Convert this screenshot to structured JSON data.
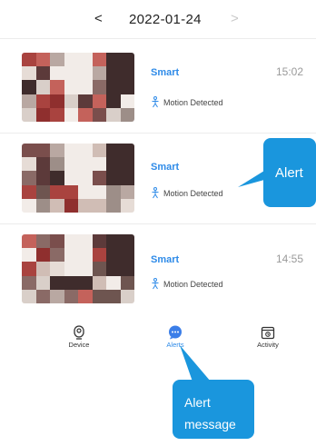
{
  "date_nav": {
    "prev_icon": "chevron-left-icon",
    "prev_glyph": "<",
    "date": "2022-01-24",
    "next_icon": "chevron-right-icon",
    "next_glyph": ">"
  },
  "events": [
    {
      "title": "Smart",
      "time": "15:02",
      "type": "Motion Detected",
      "icon": "motion-person-icon"
    },
    {
      "title": "Smart",
      "time": "",
      "type": "Motion Detected",
      "icon": "motion-person-icon"
    },
    {
      "title": "Smart",
      "time": "14:55",
      "type": "Motion Detected",
      "icon": "motion-person-icon"
    }
  ],
  "tabs": [
    {
      "label": "Device",
      "icon": "camera-icon",
      "active": false
    },
    {
      "label": "Alerts",
      "icon": "chat-bubble-icon",
      "active": true
    },
    {
      "label": "Activity",
      "icon": "activity-icon",
      "active": false
    }
  ],
  "callouts": [
    {
      "text": "Alert"
    },
    {
      "line1": "Alert",
      "line2": "message"
    }
  ],
  "colors": {
    "accent": "#2f8be8",
    "callout_bg": "#1a96dd",
    "time_gray": "#9a9a9a",
    "divider": "#ececec"
  }
}
